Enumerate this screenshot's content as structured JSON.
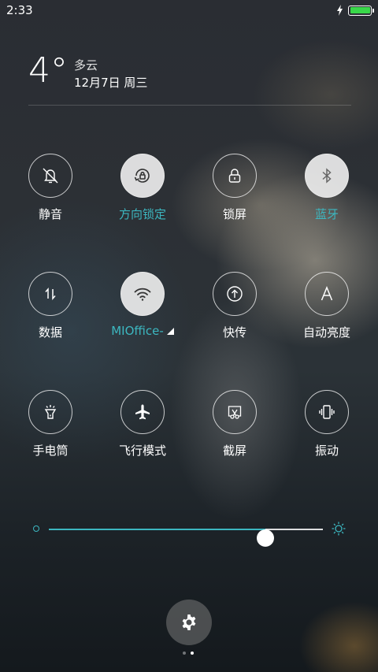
{
  "status_bar": {
    "time": "2:33",
    "battery_level": 1.0,
    "charging": true,
    "battery_color": "#39d84a"
  },
  "weather": {
    "temperature": "4°",
    "condition": "多云",
    "date": "12月7日 周三"
  },
  "toggles": [
    {
      "id": "silent",
      "label": "静音",
      "icon": "bell-off-icon",
      "active": false
    },
    {
      "id": "rotation-lock",
      "label": "方向锁定",
      "icon": "rotation-lock-icon",
      "active": true
    },
    {
      "id": "lock-screen",
      "label": "锁屏",
      "icon": "lock-icon",
      "active": false
    },
    {
      "id": "bluetooth",
      "label": "蓝牙",
      "icon": "bluetooth-icon",
      "active": true
    },
    {
      "id": "data",
      "label": "数据",
      "icon": "data-arrows-icon",
      "active": false
    },
    {
      "id": "wifi",
      "label": "MIOffice-",
      "icon": "wifi-icon",
      "active": true
    },
    {
      "id": "quick-share",
      "label": "快传",
      "icon": "upload-icon",
      "active": false
    },
    {
      "id": "auto-brightness",
      "label": "自动亮度",
      "icon": "auto-brightness-icon",
      "active": false
    },
    {
      "id": "flashlight",
      "label": "手电筒",
      "icon": "flashlight-icon",
      "active": false
    },
    {
      "id": "airplane",
      "label": "飞行模式",
      "icon": "airplane-icon",
      "active": false
    },
    {
      "id": "screenshot",
      "label": "截屏",
      "icon": "screenshot-icon",
      "active": false
    },
    {
      "id": "vibrate",
      "label": "振动",
      "icon": "vibrate-icon",
      "active": false
    }
  ],
  "brightness": {
    "level": 0.79
  },
  "colors": {
    "accent": "#3cb7c0"
  },
  "pager": {
    "page_count": 2,
    "current": 2
  }
}
